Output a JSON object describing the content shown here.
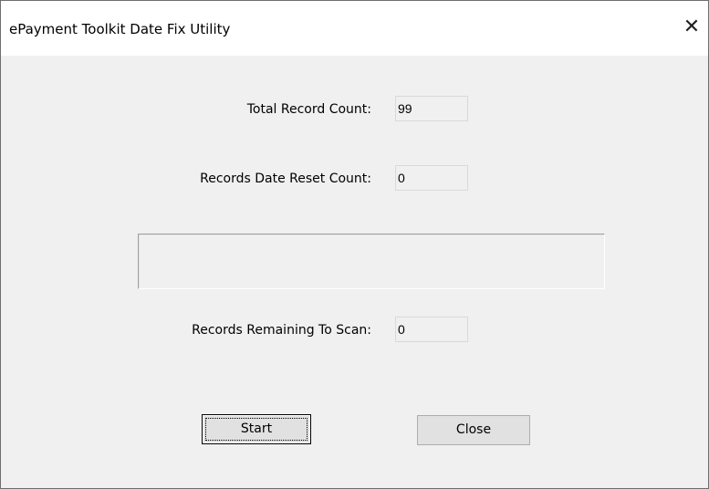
{
  "window": {
    "title": "ePayment Toolkit Date Fix Utility",
    "close_glyph": "✕"
  },
  "fields": {
    "total_record_count": {
      "label": "Total Record Count:",
      "value": "99"
    },
    "records_date_reset_count": {
      "label": "Records Date Reset Count:",
      "value": "0"
    },
    "records_remaining_to_scan": {
      "label": "Records Remaining To Scan:",
      "value": "0"
    }
  },
  "status_box": {
    "text": ""
  },
  "buttons": {
    "start_label": "Start",
    "close_label": "Close"
  }
}
